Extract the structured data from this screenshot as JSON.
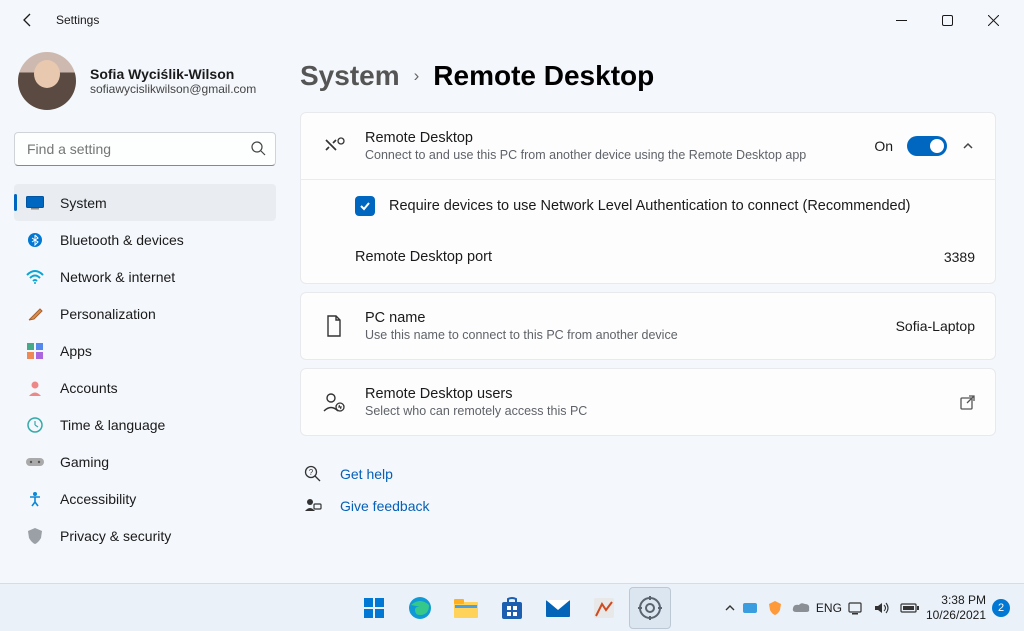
{
  "window": {
    "title": "Settings"
  },
  "user": {
    "name": "Sofia Wyciślik-Wilson",
    "email": "sofiawycislikwilson@gmail.com"
  },
  "search": {
    "placeholder": "Find a setting"
  },
  "nav": {
    "items": [
      {
        "label": "System"
      },
      {
        "label": "Bluetooth & devices"
      },
      {
        "label": "Network & internet"
      },
      {
        "label": "Personalization"
      },
      {
        "label": "Apps"
      },
      {
        "label": "Accounts"
      },
      {
        "label": "Time & language"
      },
      {
        "label": "Gaming"
      },
      {
        "label": "Accessibility"
      },
      {
        "label": "Privacy & security"
      }
    ]
  },
  "breadcrumb": {
    "part1": "System",
    "part2": "Remote Desktop"
  },
  "remote_desktop": {
    "title": "Remote Desktop",
    "subtitle": "Connect to and use this PC from another device using the Remote Desktop app",
    "status_label": "On",
    "nla_label": "Require devices to use Network Level Authentication to connect (Recommended)",
    "port_label": "Remote Desktop port",
    "port_value": "3389"
  },
  "pc_name": {
    "title": "PC name",
    "subtitle": "Use this name to connect to this PC from another device",
    "value": "Sofia-Laptop"
  },
  "rd_users": {
    "title": "Remote Desktop users",
    "subtitle": "Select who can remotely access this PC"
  },
  "help": {
    "get_help": "Get help",
    "feedback": "Give feedback"
  },
  "taskbar": {
    "lang": "ENG",
    "time": "3:38 PM",
    "date": "10/26/2021",
    "notif_count": "2"
  }
}
